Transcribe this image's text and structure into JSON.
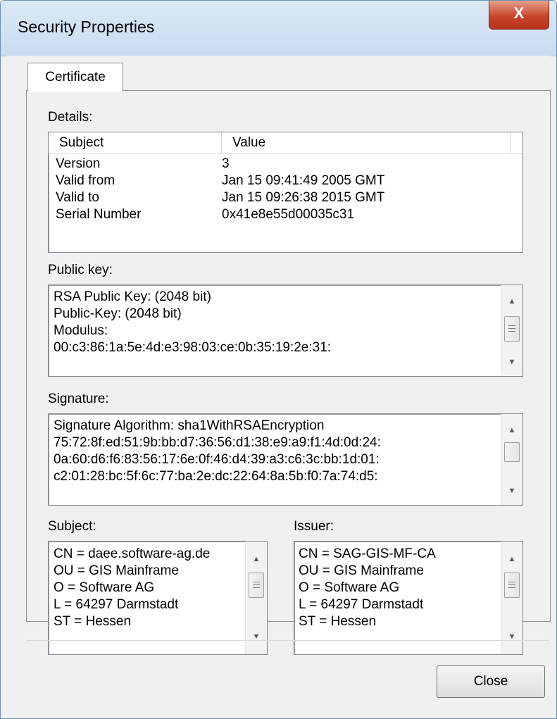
{
  "window": {
    "title": "Security Properties",
    "close_glyph": "X"
  },
  "tabs": [
    {
      "label": "Certificate",
      "selected": true
    }
  ],
  "details": {
    "label": "Details:",
    "columns": [
      "Subject",
      "Value"
    ],
    "rows": [
      {
        "subject": "Version",
        "value": "3"
      },
      {
        "subject": "Valid from",
        "value": "Jan 15 09:41:49 2005 GMT"
      },
      {
        "subject": "Valid to",
        "value": "Jan 15 09:26:38 2015 GMT"
      },
      {
        "subject": "Serial Number",
        "value": "0x41e8e55d00035c31"
      }
    ]
  },
  "public_key": {
    "label": "Public key:",
    "lines": [
      "RSA Public Key: (2048 bit)",
      "Public-Key: (2048 bit)",
      "Modulus:",
      "00:c3:86:1a:5e:4d:e3:98:03:ce:0b:35:19:2e:31:"
    ]
  },
  "signature": {
    "label": "Signature:",
    "lines": [
      "Signature Algorithm: sha1WithRSAEncryption",
      "75:72:8f:ed:51:9b:bb:d7:36:56:d1:38:e9:a9:f1:4d:0d:24:",
      "0a:60:d6:f6:83:56:17:6e:0f:46:d4:39:a3:c6:3c:bb:1d:01:",
      "c2:01:28:bc:5f:6c:77:ba:2e:dc:22:64:8a:5b:f0:7a:74:d5:"
    ]
  },
  "subject": {
    "label": "Subject:",
    "lines": [
      "CN = daee.software-ag.de",
      "OU = GIS Mainframe",
      "O = Software AG",
      "L = 64297 Darmstadt",
      "ST = Hessen"
    ]
  },
  "issuer": {
    "label": "Issuer:",
    "lines": [
      "CN = SAG-GIS-MF-CA",
      "OU = GIS Mainframe",
      "O = Software AG",
      "L = 64297 Darmstadt",
      "ST = Hessen"
    ]
  },
  "icons": {
    "scroll_up": "▲",
    "scroll_down": "▼"
  },
  "buttons": {
    "close_label": "Close"
  }
}
